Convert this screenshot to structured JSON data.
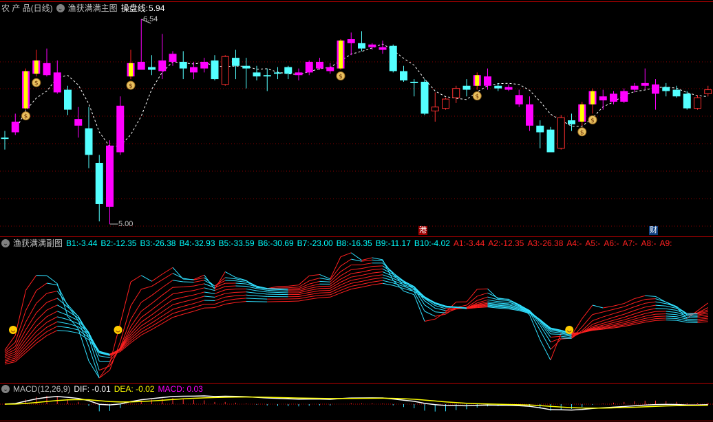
{
  "main": {
    "symbol": "农 产 品(日线)",
    "indicator": "渔获满满主图",
    "line_label": "操盘线:",
    "line_value": "5.94",
    "high_label": "6.54",
    "low_label": "5.00",
    "price_high": 6.54,
    "price_low": 5.0,
    "markers": [
      {
        "text": "港",
        "bg": "#a00000"
      },
      {
        "text": "财",
        "bg": "#104080"
      }
    ],
    "colors": {
      "up": "#ff00ff",
      "down": "#54ffff",
      "hollow": "#ff3030",
      "signal_stripe": "#ffff00",
      "ma": "#ffffff",
      "grid": "#8b0000"
    },
    "candles": [
      [
        5.65,
        5.64,
        5.7,
        5.56,
        "down"
      ],
      [
        5.69,
        5.77,
        5.83,
        5.67,
        "up"
      ],
      [
        5.87,
        6.15,
        6.17,
        5.86,
        "sig"
      ],
      [
        6.13,
        6.23,
        6.31,
        6.11,
        "sig"
      ],
      [
        6.12,
        6.21,
        6.32,
        6.11,
        "up"
      ],
      [
        5.99,
        6.14,
        6.23,
        5.98,
        "up"
      ],
      [
        6.01,
        5.86,
        6.04,
        5.82,
        "down"
      ],
      [
        5.74,
        5.79,
        5.88,
        5.65,
        "up"
      ],
      [
        5.72,
        5.52,
        5.88,
        5.42,
        "down"
      ],
      [
        5.46,
        5.15,
        5.52,
        5.02,
        "down"
      ],
      [
        5.13,
        5.59,
        5.63,
        5.0,
        "up"
      ],
      [
        5.54,
        5.89,
        5.96,
        5.52,
        "up"
      ],
      [
        6.11,
        6.21,
        6.31,
        6.09,
        "sig"
      ],
      [
        6.16,
        6.22,
        6.54,
        6.16,
        "up"
      ],
      [
        6.18,
        6.16,
        6.27,
        6.12,
        "down"
      ],
      [
        6.15,
        6.23,
        6.43,
        6.09,
        "up"
      ],
      [
        6.22,
        6.28,
        6.3,
        6.19,
        "up"
      ],
      [
        6.22,
        6.17,
        6.3,
        6.09,
        "down"
      ],
      [
        6.14,
        6.18,
        6.22,
        6.09,
        "up"
      ],
      [
        6.17,
        6.22,
        6.25,
        6.14,
        "up"
      ],
      [
        6.23,
        6.09,
        6.27,
        6.08,
        "down"
      ],
      [
        6.05,
        6.26,
        6.27,
        6.04,
        "hollow"
      ],
      [
        6.25,
        6.19,
        6.31,
        6.09,
        "down"
      ],
      [
        6.19,
        6.17,
        6.25,
        6.02,
        "down"
      ],
      [
        6.14,
        6.11,
        6.19,
        6.08,
        "down"
      ],
      [
        6.12,
        6.11,
        6.17,
        6.0,
        "down"
      ],
      [
        6.14,
        6.13,
        6.18,
        6.09,
        "down"
      ],
      [
        6.18,
        6.13,
        6.19,
        6.09,
        "down"
      ],
      [
        6.12,
        6.14,
        6.17,
        6.08,
        "up"
      ],
      [
        6.14,
        6.22,
        6.23,
        6.12,
        "up"
      ],
      [
        6.17,
        6.22,
        6.25,
        6.16,
        "up"
      ],
      [
        6.15,
        6.18,
        6.21,
        6.13,
        "up"
      ],
      [
        6.17,
        6.38,
        6.39,
        6.16,
        "sig"
      ],
      [
        6.36,
        6.39,
        6.44,
        6.27,
        "up"
      ],
      [
        6.36,
        6.32,
        6.45,
        6.3,
        "down"
      ],
      [
        6.33,
        6.35,
        6.36,
        6.31,
        "up"
      ],
      [
        6.31,
        6.33,
        6.38,
        6.28,
        "up"
      ],
      [
        6.34,
        6.15,
        6.35,
        6.14,
        "down"
      ],
      [
        6.15,
        6.08,
        6.19,
        6.07,
        "down"
      ],
      [
        6.07,
        6.06,
        6.09,
        5.96,
        "down"
      ],
      [
        6.07,
        5.83,
        6.09,
        5.82,
        "down"
      ],
      [
        5.85,
        5.88,
        5.99,
        5.77,
        "hollow"
      ],
      [
        5.87,
        5.94,
        5.95,
        5.86,
        "hollow"
      ],
      [
        5.95,
        6.02,
        6.04,
        5.91,
        "hollow"
      ],
      [
        6.04,
        6.01,
        6.09,
        5.96,
        "down"
      ],
      [
        6.04,
        6.12,
        6.14,
        6.01,
        "sig"
      ],
      [
        6.04,
        6.11,
        6.17,
        6.01,
        "up"
      ],
      [
        6.04,
        6.02,
        6.06,
        6.0,
        "down"
      ],
      [
        6.01,
        6.03,
        6.05,
        6.0,
        "up"
      ],
      [
        5.9,
        5.97,
        6.01,
        5.88,
        "up"
      ],
      [
        5.74,
        5.9,
        5.96,
        5.7,
        "up"
      ],
      [
        5.74,
        5.69,
        5.78,
        5.57,
        "down"
      ],
      [
        5.71,
        5.54,
        5.73,
        5.54,
        "down"
      ],
      [
        5.57,
        5.8,
        5.82,
        5.56,
        "hollow"
      ],
      [
        5.78,
        5.75,
        5.83,
        5.7,
        "down"
      ],
      [
        5.77,
        5.9,
        5.92,
        5.74,
        "sig"
      ],
      [
        5.9,
        6.0,
        6.02,
        5.83,
        "sig"
      ],
      [
        5.93,
        5.96,
        6.01,
        5.86,
        "up"
      ],
      [
        5.92,
        5.98,
        6.0,
        5.9,
        "up"
      ],
      [
        5.92,
        6.0,
        6.02,
        5.91,
        "up"
      ],
      [
        6.01,
        6.04,
        6.06,
        5.99,
        "up"
      ],
      [
        6.04,
        6.06,
        6.17,
        6.01,
        "up"
      ],
      [
        5.98,
        6.05,
        6.09,
        5.86,
        "up"
      ],
      [
        6.03,
        6.0,
        6.06,
        5.96,
        "down"
      ],
      [
        6.01,
        5.96,
        6.04,
        5.95,
        "down"
      ],
      [
        5.98,
        5.87,
        6.0,
        5.86,
        "down"
      ],
      [
        5.87,
        5.95,
        5.97,
        5.86,
        "hollow"
      ],
      [
        5.98,
        6.01,
        6.04,
        5.96,
        "hollow"
      ]
    ]
  },
  "sub": {
    "indicator": "渔获满满副图",
    "b_values": [
      {
        "label": "B1:",
        "value": "-3.44"
      },
      {
        "label": "B2:",
        "value": "-12.35"
      },
      {
        "label": "B3:",
        "value": "-26.38"
      },
      {
        "label": "B4:",
        "value": "-32.93"
      },
      {
        "label": "B5:",
        "value": "-33.59"
      },
      {
        "label": "B6:",
        "value": "-30.69"
      },
      {
        "label": "B7:",
        "value": "-23.00"
      },
      {
        "label": "B8:",
        "value": "-16.35"
      },
      {
        "label": "B9:",
        "value": "-11.17"
      },
      {
        "label": "B10:",
        "value": "-4.02"
      }
    ],
    "a_values": [
      {
        "label": "A1:",
        "value": "-3.44"
      },
      {
        "label": "A2:",
        "value": "-12.35"
      },
      {
        "label": "A3:",
        "value": "-26.38"
      },
      {
        "label": "A4:",
        "value": "-"
      },
      {
        "label": "A5:",
        "value": "-"
      },
      {
        "label": "A6:",
        "value": "-"
      },
      {
        "label": "A7:",
        "value": "-"
      },
      {
        "label": "A8:",
        "value": "-"
      },
      {
        "label": "A9:",
        "value": ""
      }
    ],
    "smiley_candles": [
      0,
      10,
      53
    ]
  },
  "macd": {
    "indicator": "MACD(12,26,9)",
    "dif_label": "DIF:",
    "dif_value": "-0.01",
    "dea_label": "DEA:",
    "dea_value": "-0.02",
    "macd_label": "MACD:",
    "macd_value": "0.03"
  }
}
